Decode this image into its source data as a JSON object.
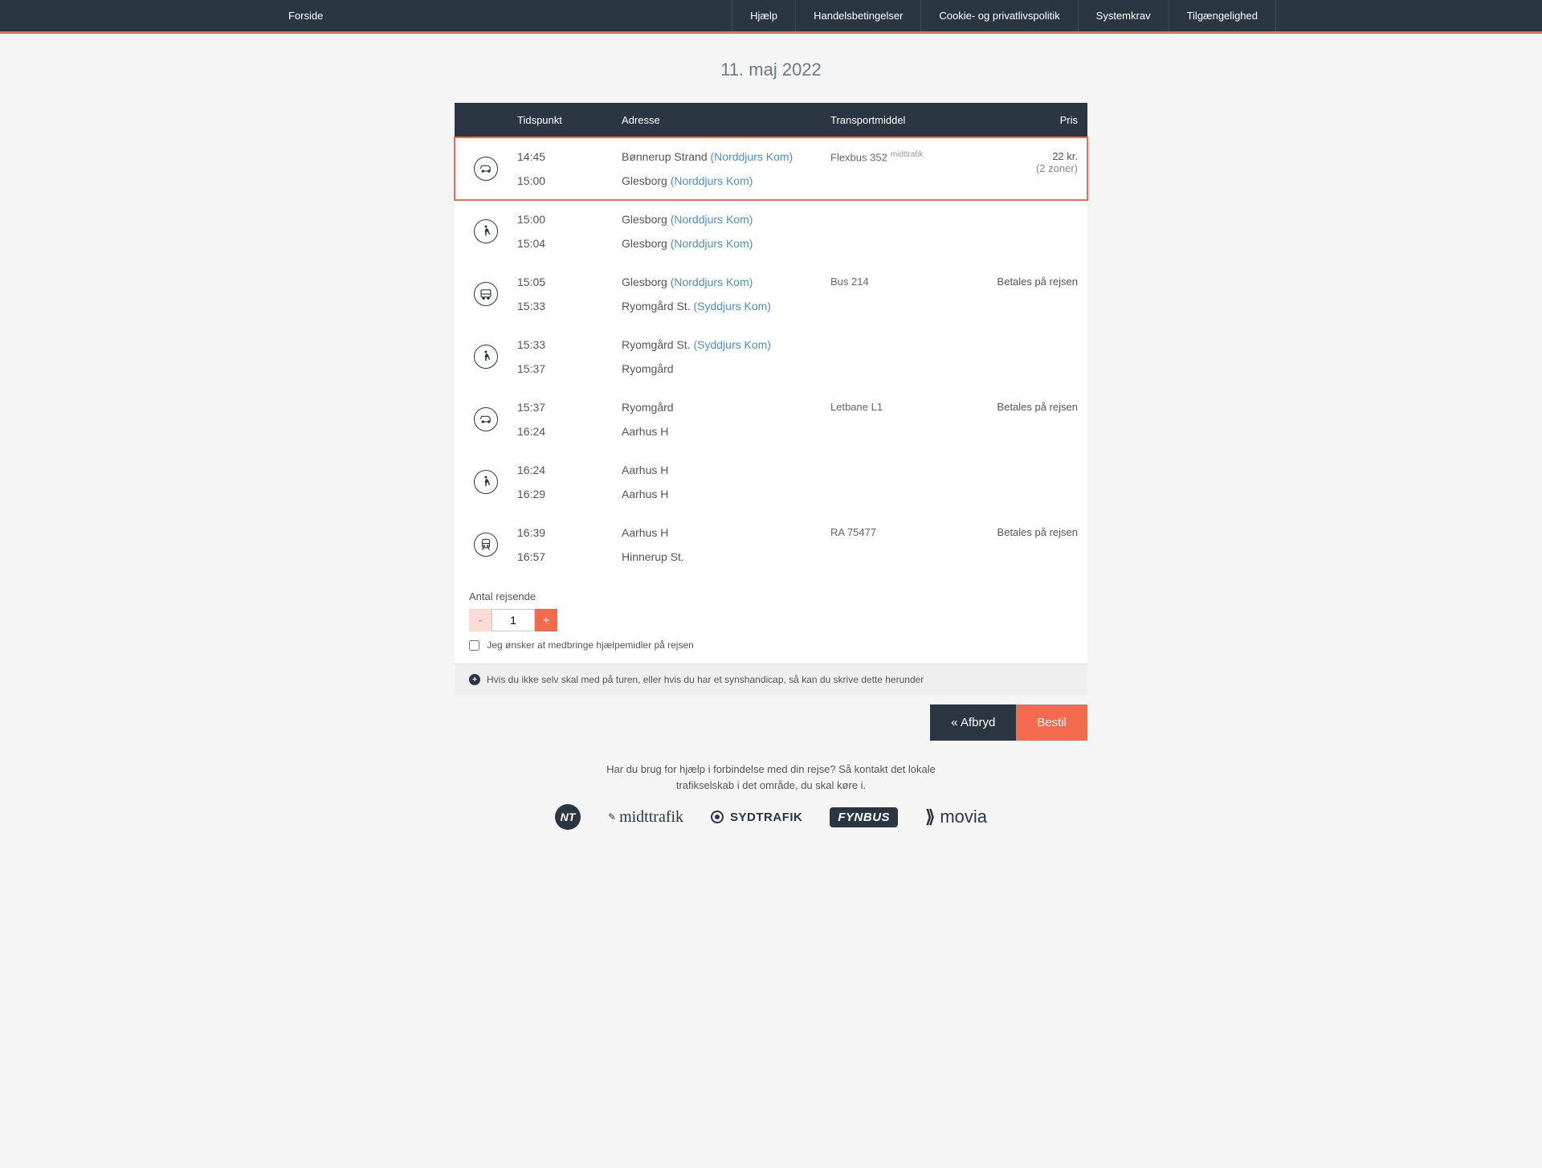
{
  "nav": {
    "forside": "Forside",
    "hjaelp": "Hjælp",
    "handel": "Handelsbetingelser",
    "cookie": "Cookie- og privatlivspolitik",
    "system": "Systemkrav",
    "tilg": "Tilgængelighed"
  },
  "date_title": "11. maj 2022",
  "headers": {
    "time": "Tidspunkt",
    "addr": "Adresse",
    "trans": "Transportmiddel",
    "price": "Pris"
  },
  "segments": [
    {
      "mode": "minibus",
      "highlight": true,
      "dep_time": "14:45",
      "dep_place": "Bønnerup Strand",
      "dep_paren": "(Norddjurs Kom)",
      "arr_time": "15:00",
      "arr_place": "Glesborg",
      "arr_paren": "(Norddjurs Kom)",
      "transport": "Flexbus 352",
      "transport_logo": "midttrafik",
      "price": "22 kr.",
      "price_sub": "(2 zoner)"
    },
    {
      "mode": "walk",
      "dep_time": "15:00",
      "dep_place": "Glesborg",
      "dep_paren": "(Norddjurs Kom)",
      "arr_time": "15:04",
      "arr_place": "Glesborg",
      "arr_paren": "(Norddjurs Kom)",
      "transport": "",
      "price": ""
    },
    {
      "mode": "bus",
      "dep_time": "15:05",
      "dep_place": "Glesborg",
      "dep_paren": "(Norddjurs Kom)",
      "arr_time": "15:33",
      "arr_place": "Ryomgård St.",
      "arr_paren": "(Syddjurs Kom)",
      "transport": "Bus 214",
      "price": "Betales på rejsen"
    },
    {
      "mode": "walk",
      "dep_time": "15:33",
      "dep_place": "Ryomgård St.",
      "dep_paren": "(Syddjurs Kom)",
      "arr_time": "15:37",
      "arr_place": "Ryomgård",
      "arr_paren": "",
      "transport": "",
      "price": ""
    },
    {
      "mode": "tram",
      "dep_time": "15:37",
      "dep_place": "Ryomgård",
      "dep_paren": "",
      "arr_time": "16:24",
      "arr_place": "Aarhus H",
      "arr_paren": "",
      "transport": "Letbane L1",
      "price": "Betales på rejsen"
    },
    {
      "mode": "walk",
      "dep_time": "16:24",
      "dep_place": "Aarhus H",
      "dep_paren": "",
      "arr_time": "16:29",
      "arr_place": "Aarhus H",
      "arr_paren": "",
      "transport": "",
      "price": ""
    },
    {
      "mode": "train",
      "dep_time": "16:39",
      "dep_place": "Aarhus H",
      "dep_paren": "",
      "arr_time": "16:57",
      "arr_place": "Hinnerup St.",
      "arr_paren": "",
      "transport": "RA 75477",
      "price": "Betales på rejsen"
    }
  ],
  "passengers": {
    "label": "Antal rejsende",
    "value": "1",
    "minus": "-",
    "plus": "+"
  },
  "aid_checkbox": "Jeg ønsker at medbringe hjælpemidler på rejsen",
  "expander_text": "Hvis du ikke selv skal med på turen, eller hvis du har et synshandicap, så kan du skrive dette herunder",
  "expander_icon": "+",
  "actions": {
    "cancel": "« Afbryd",
    "order": "Bestil"
  },
  "footer_help": "Har du brug for hjælp i forbindelse med din rejse? Så kontakt det lokale trafikselskab i det område, du skal køre i.",
  "logos": {
    "nt": "NT",
    "midttrafik": "midttrafik",
    "sydtrafik": "SYDTRAFIK",
    "fynbus": "FYNBUS",
    "movia": "movia"
  }
}
